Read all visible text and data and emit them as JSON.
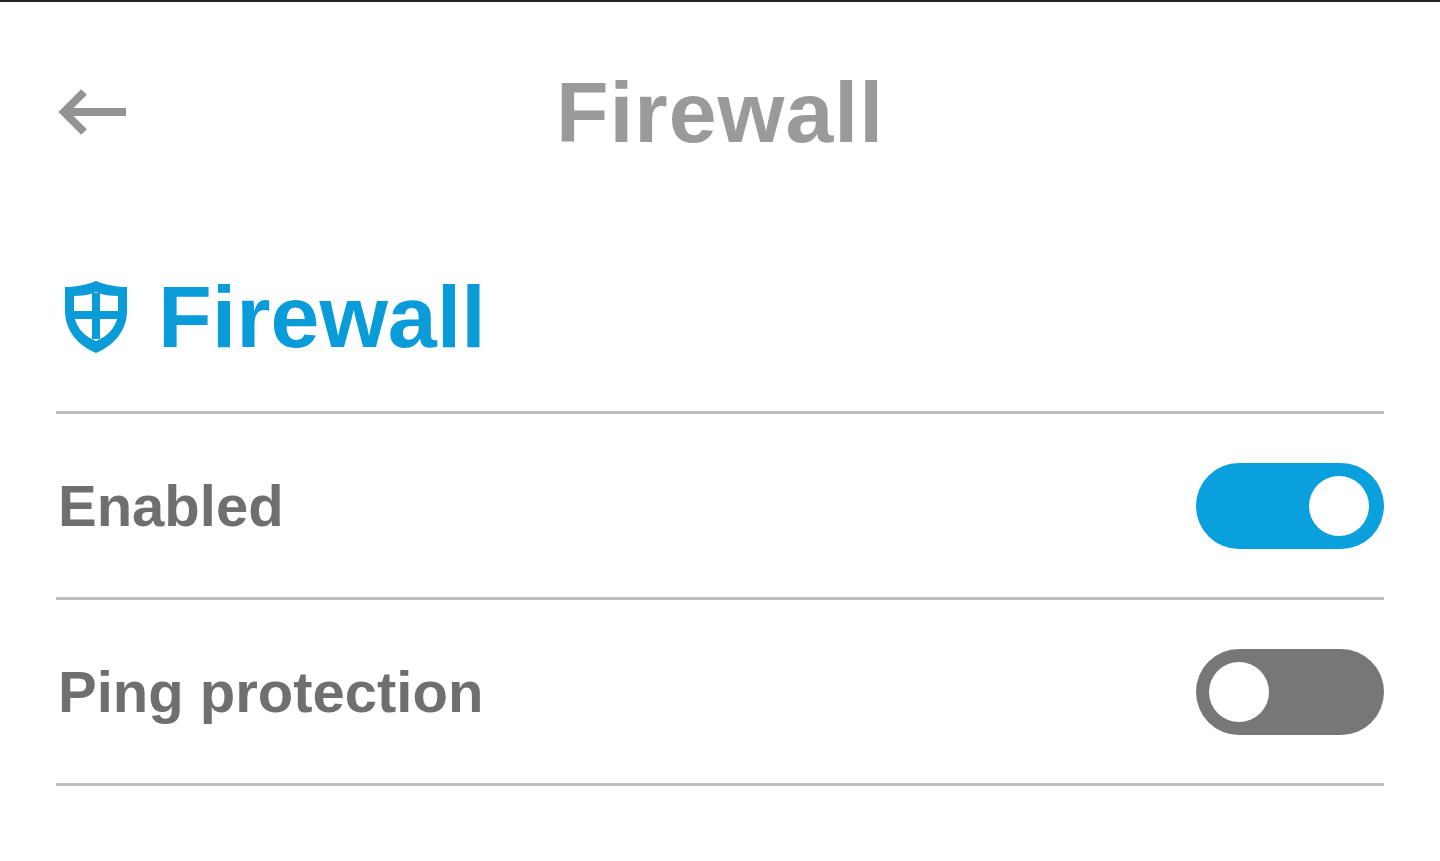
{
  "header": {
    "title": "Firewall"
  },
  "section": {
    "title": "Firewall"
  },
  "settings": [
    {
      "label": "Enabled",
      "on": true
    },
    {
      "label": "Ping protection",
      "on": false
    }
  ]
}
